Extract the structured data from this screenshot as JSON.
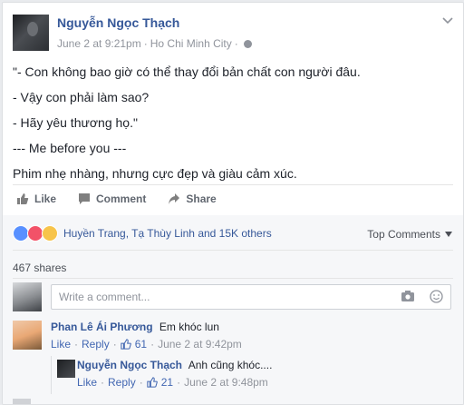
{
  "post": {
    "author": "Nguyễn Ngọc Thạch",
    "date": "June 2 at 9:21pm",
    "separator": "·",
    "location": "Ho Chi Minh City",
    "separator2": "·",
    "lines": [
      "\"- Con không bao giờ có thể thay đổi bản chất con người đâu.",
      "- Vậy con phải làm sao?",
      "- Hãy yêu thương họ.\"",
      "--- Me before you ---",
      "Phim nhẹ nhàng, nhưng cực đẹp và giàu cảm xúc."
    ]
  },
  "actions": {
    "like": "Like",
    "comment": "Comment",
    "share": "Share"
  },
  "reactions": {
    "summary": "Huyền Trang, Tạ Thùy Linh and 15K others",
    "sort_label": "Top Comments",
    "shares": "467 shares"
  },
  "composer": {
    "placeholder": "Write a comment..."
  },
  "comments": [
    {
      "name": "Phan Lê Ái Phương",
      "text": "Em khóc lun",
      "like": "Like",
      "reply": "Reply",
      "likes": "61",
      "time": "June 2 at 9:42pm"
    },
    {
      "name": "Nguyễn Ngọc Thạch",
      "text": "Anh cũng khóc....",
      "like": "Like",
      "reply": "Reply",
      "likes": "21",
      "time": "June 2 at 9:48pm"
    }
  ],
  "meta_dot": "·",
  "colors": {
    "link": "#365899",
    "meta": "#90949c",
    "like_reaction": "#5890ff",
    "love_reaction": "#f25268",
    "sad_reaction": "#f7c44b"
  }
}
